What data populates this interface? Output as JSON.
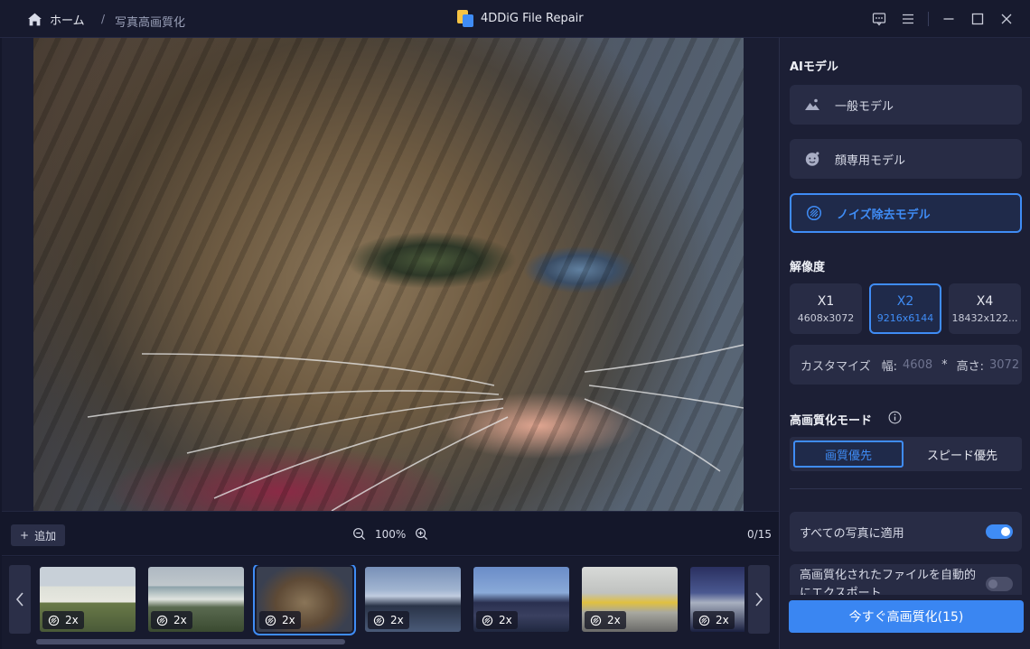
{
  "titlebar": {
    "home_label": "ホーム",
    "separator": "/",
    "breadcrumb": "写真高画質化",
    "app_title": "4DDiG File Repair"
  },
  "preview": {
    "add_label": "追加",
    "zoom_level": "100%",
    "counter": "0/15"
  },
  "thumbnails": [
    {
      "scale": "2x",
      "selected": false
    },
    {
      "scale": "2x",
      "selected": false
    },
    {
      "scale": "2x",
      "selected": true
    },
    {
      "scale": "2x",
      "selected": false
    },
    {
      "scale": "2x",
      "selected": false
    },
    {
      "scale": "2x",
      "selected": false
    },
    {
      "scale": "2x",
      "selected": false
    }
  ],
  "panel": {
    "ai_model_title": "AIモデル",
    "models": [
      {
        "label": "一般モデル",
        "icon": "mountain-icon",
        "active": false
      },
      {
        "label": "顔専用モデル",
        "icon": "face-icon",
        "active": false
      },
      {
        "label": "ノイズ除去モデル",
        "icon": "noise-icon",
        "active": true
      }
    ],
    "resolution_title": "解像度",
    "resolutions": [
      {
        "name": "X1",
        "dims": "4608x3072",
        "active": false
      },
      {
        "name": "X2",
        "dims": "9216x6144",
        "active": true
      },
      {
        "name": "X4",
        "dims": "18432x122...",
        "active": false
      }
    ],
    "custom": {
      "label": "カスタマイズ",
      "width_label": "幅:",
      "width_placeholder": "4608",
      "times": "*",
      "height_label": "高さ:",
      "height_placeholder": "3072"
    },
    "mode_title": "高画質化モード",
    "modes": [
      {
        "label": "画質優先",
        "active": true
      },
      {
        "label": "スピード優先",
        "active": false
      }
    ],
    "apply_all_label": "すべての写真に適用",
    "apply_all_on": true,
    "autosave_label": "高画質化されたファイルを自動的にエクスポート",
    "autosave_on": false,
    "cta_label": "今すぐ高画質化(15)"
  },
  "colors": {
    "accent": "#3f8cf5",
    "background": "#14172a",
    "panel": "#1c1f35",
    "card": "#282c45"
  }
}
